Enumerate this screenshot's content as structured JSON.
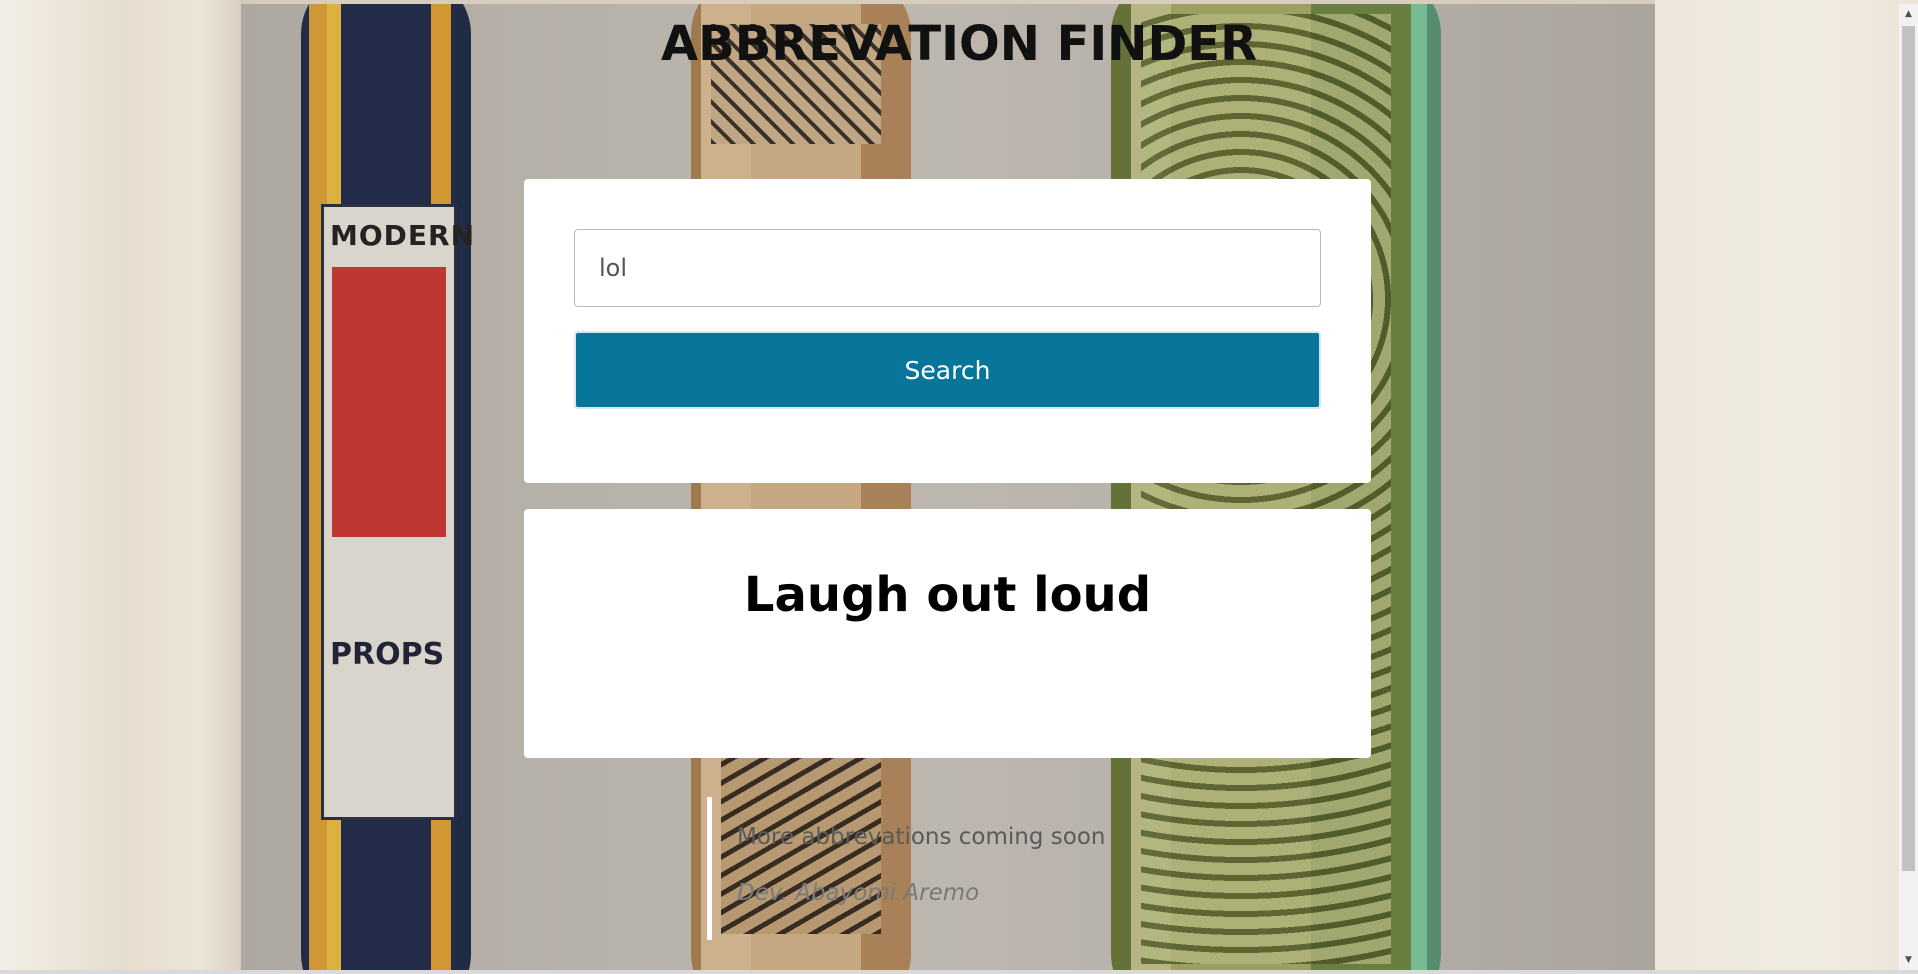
{
  "header": {
    "title": "ABBREVATION FINDER"
  },
  "search": {
    "value": "lol",
    "button_label": "Search"
  },
  "result": {
    "text": "Laugh out loud"
  },
  "footer": {
    "note": "More abbrevations coming soon",
    "author": "Dev. Abayomi Aremo"
  },
  "background": {
    "board1_top_text": "MODERN",
    "board1_bottom_text": "PROPS"
  },
  "colors": {
    "button_bg": "#08769a",
    "card_bg": "#ffffff",
    "title_color": "#111111"
  },
  "icons": {
    "scroll_up": "▲",
    "scroll_down": "▼"
  }
}
